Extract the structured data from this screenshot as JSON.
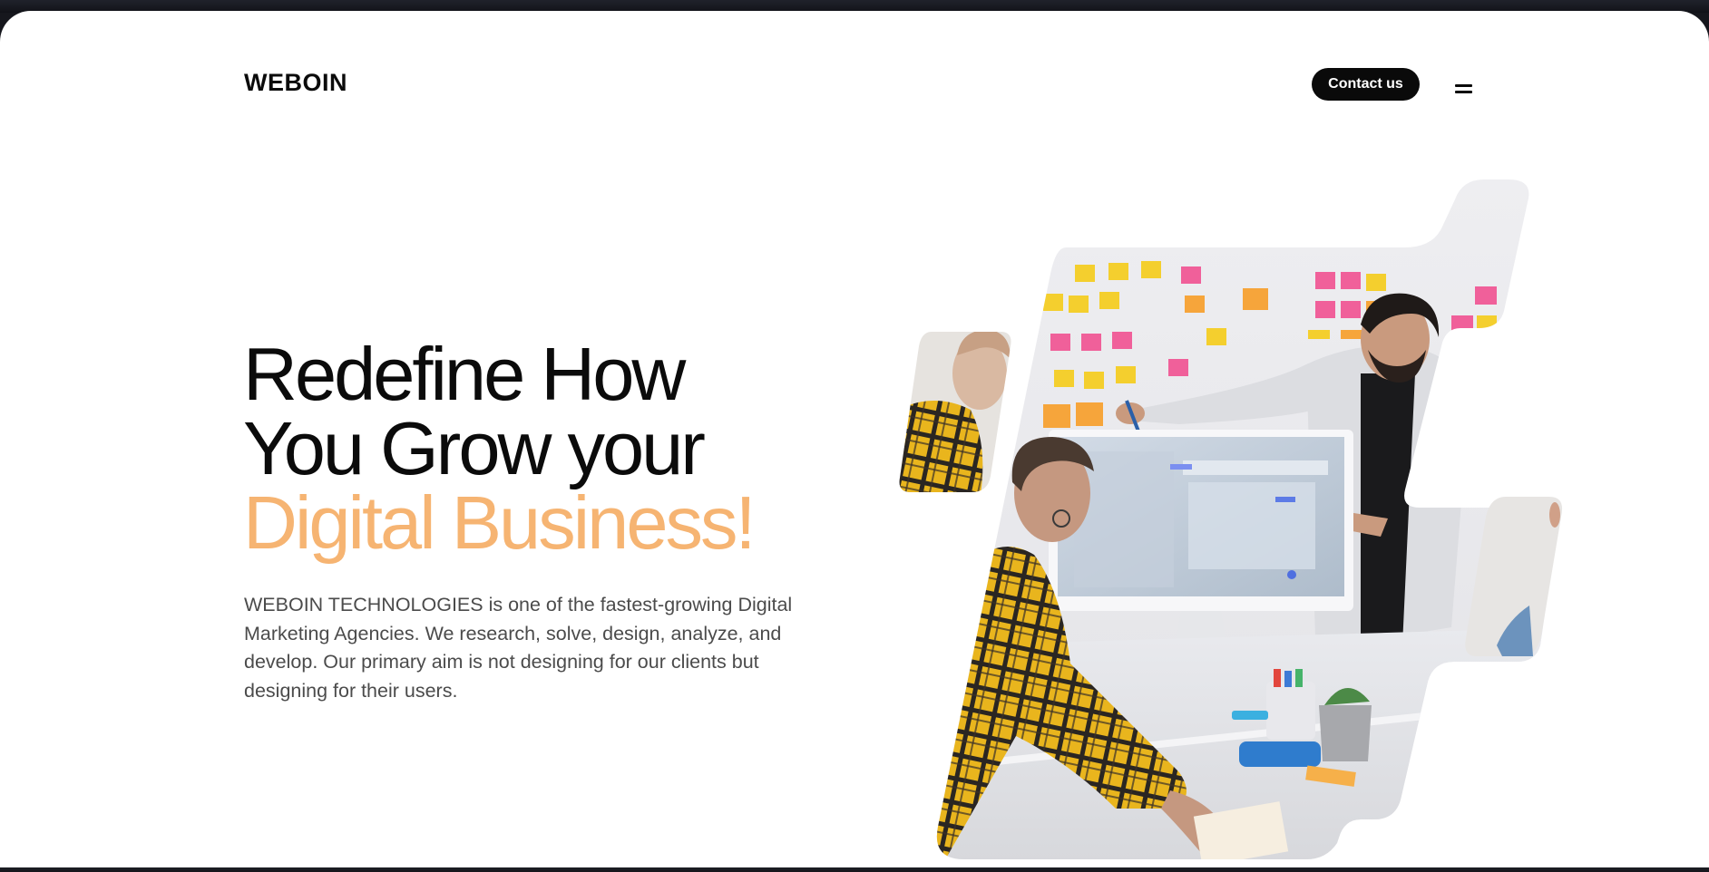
{
  "brand": {
    "logo_text": "WEBOIN"
  },
  "header": {
    "contact_label": "Contact us",
    "menu_icon": "hamburger-menu-icon"
  },
  "hero": {
    "headline_line1": "Redefine How",
    "headline_line2": "You Grow your",
    "headline_accent": "Digital Business!",
    "description": "WEBOIN TECHNOLOGIES is one of the fastest-growing Digital Marketing Agencies. We research, solve, design, analyze, and develop. Our primary aim is not designing for our clients but designing for their users."
  },
  "colors": {
    "accent": "#f6b472",
    "text_dark": "#0b0b0b",
    "button_bg": "#0a0a0a",
    "body_text": "#4b4b4b"
  }
}
